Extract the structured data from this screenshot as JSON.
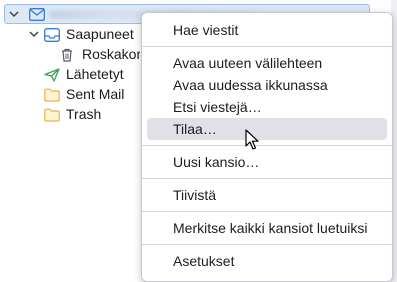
{
  "folder_tree": {
    "account": {
      "name_redacted": true
    },
    "items": [
      {
        "label": "Saapuneet",
        "icon": "inbox-icon",
        "expanded": true
      },
      {
        "label": "Roskakori",
        "icon": "trash-icon"
      },
      {
        "label": "Lähetetyt",
        "icon": "sent-icon"
      },
      {
        "label": "Sent Mail",
        "icon": "folder-icon"
      },
      {
        "label": "Trash",
        "icon": "folder-icon"
      }
    ]
  },
  "context_menu": {
    "items": [
      {
        "label": "Hae viestit",
        "group": 1
      },
      {
        "label": "Avaa uuteen välilehteen",
        "group": 2
      },
      {
        "label": "Avaa uudessa ikkunassa",
        "group": 2
      },
      {
        "label": "Etsi viestejä…",
        "group": 2
      },
      {
        "label": "Tilaa…",
        "group": 2,
        "hovered": true
      },
      {
        "label": "Uusi kansio…",
        "group": 3
      },
      {
        "label": "Tiivistä",
        "group": 4
      },
      {
        "label": "Merkitse kaikki kansiot luetuiksi",
        "group": 5
      },
      {
        "label": "Asetukset",
        "group": 6
      }
    ]
  },
  "colors": {
    "selection": "#dde8f7",
    "sent_icon": "#2fa84f",
    "inbox_icon": "#3a7bd5",
    "folder_icon": "#e8b54d",
    "menu_hover": "#e0e0e6"
  }
}
